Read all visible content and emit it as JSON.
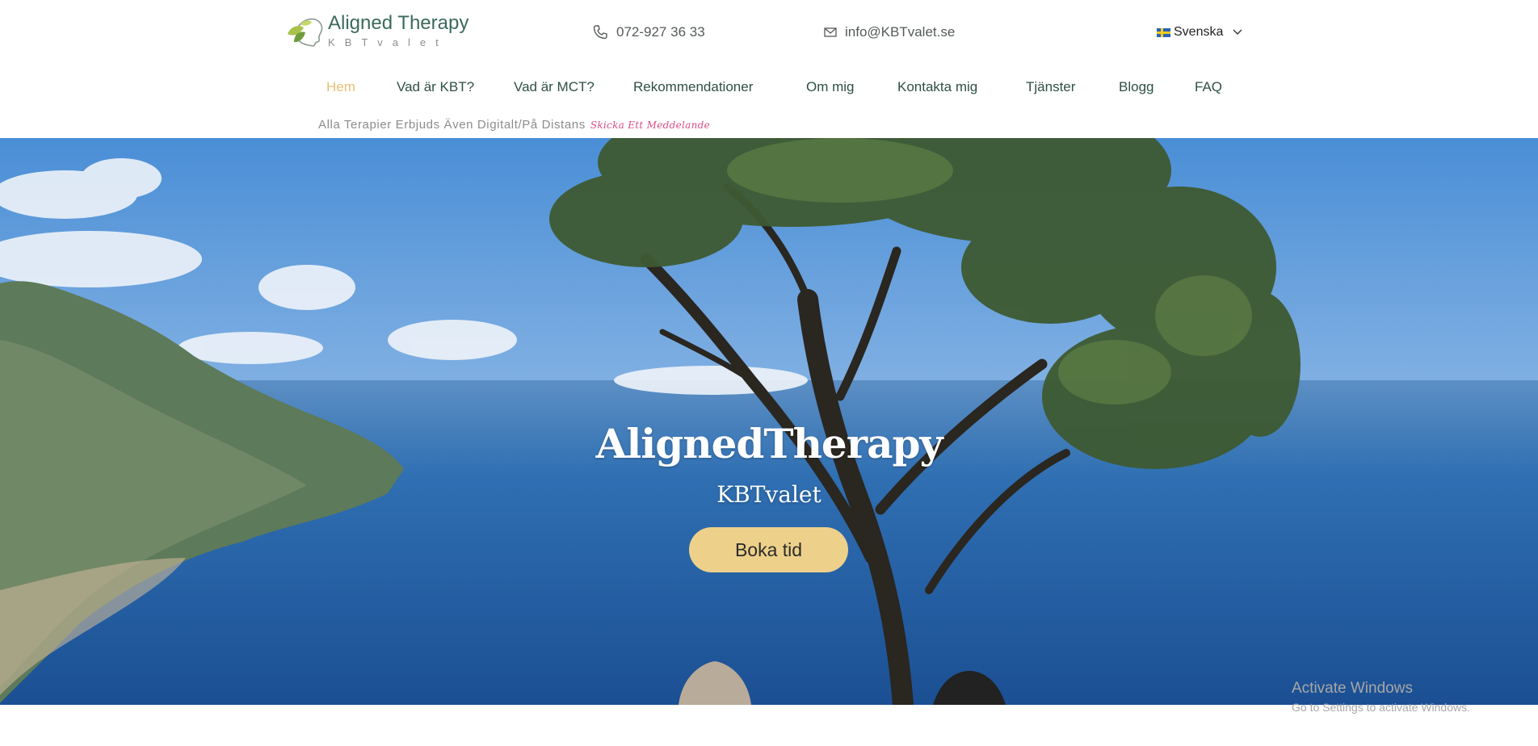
{
  "header": {
    "logo": {
      "title": "Aligned Therapy",
      "subtitle": "KBTvalet"
    },
    "phone": {
      "text": "072-927 36 33",
      "icon": "phone-icon"
    },
    "email": {
      "text": "info@KBTvalet.se",
      "icon": "mail-icon"
    },
    "language": {
      "label": "Svenska",
      "icon": "chevron-down-icon"
    }
  },
  "nav": {
    "items": [
      {
        "label": "Hem",
        "active": true
      },
      {
        "label": "Vad är KBT?"
      },
      {
        "label": "Vad är MCT?"
      },
      {
        "label": "Rekommendationer"
      },
      {
        "label": "Om mig"
      },
      {
        "label": "Kontakta mig"
      },
      {
        "label": "Tjänster"
      },
      {
        "label": "Blogg"
      },
      {
        "label": "FAQ"
      }
    ]
  },
  "tagline": {
    "text": "Alla Terapier Erbjuds Även Digitalt/På Distans",
    "link": "Skicka Ett Meddelande"
  },
  "hero": {
    "title": "AlignedTherapy",
    "subtitle": "KBTvalet",
    "cta": "Boka tid"
  },
  "overlay": {
    "line1": "Activate Windows",
    "line2": "Go to Settings to activate Windows."
  },
  "colors": {
    "accent": "#edd08a",
    "active_nav": "#e9bf74",
    "nav_text": "#2f4f47",
    "brand_green": "#3b6a5d",
    "tagline_link": "#d94c86"
  }
}
